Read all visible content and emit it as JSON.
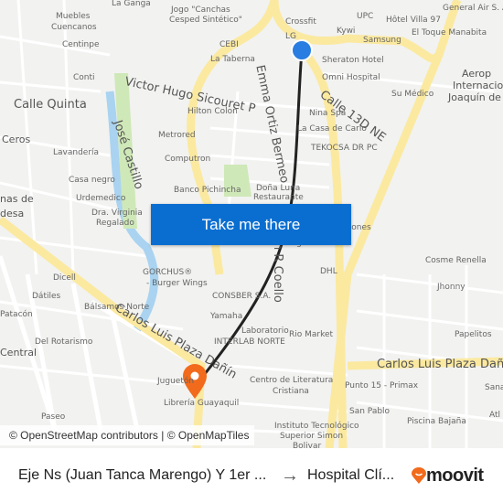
{
  "map": {
    "labels": [
      "La Ganga",
      "Jogo \"Canchas",
      "Cesped Sintético\"",
      "Crossfit",
      "UPC",
      "Hôtel Villa 97",
      "General Air S. A.",
      "Muebles",
      "Cuencanos",
      "Centinpe",
      "LG",
      "Kywi",
      "Samsung",
      "El Toque Manabita",
      "CEBI",
      "La Taberna",
      "Sheraton Hotel",
      "Conti",
      "Omni Hospital",
      "Su Médico",
      "Aerop",
      "Internacio",
      "Joaquín de",
      "Hilton Colon",
      "Nina Spa",
      "La Casa de Carlo",
      "Metrored",
      "TEKOCSA DR PC",
      "Lavandería",
      "Computron",
      "Casa negro",
      "Banco Pichincha",
      "Doña Luna",
      "Restaurante",
      "Urdemedico",
      "Dra. Virginia",
      "Regalado",
      "Samsung",
      "Colones",
      "DHL",
      "Cosme Renella",
      "Jhonny",
      "Dicell",
      "GORCHUS®",
      "- Burger Wings",
      "CONSBER S.A.",
      "Yamaha",
      "Laboratorio",
      "INTERLAB NORTE",
      "Rio Market",
      "Papelitos",
      "Juguetón",
      "Centro de Literatura",
      "Cristiana",
      "Librería Guayaquil",
      "Punto 15 - Primax",
      "San Pablo",
      "Piscina Bajaña",
      "Instituto Tecnológico",
      "Superior Simon",
      "Bolivar",
      "Paseo",
      "Dátiles",
      "Bálsamos Norte",
      "Del Rotarismo",
      "Central",
      "Patacón",
      "Ceros",
      "nas de",
      "desa",
      "Sana",
      "Atl"
    ],
    "streets": [
      "Victor Hugo Sicouret P",
      "Calle Quinta",
      "José Castillo",
      "Emma Ortiz Bermeo",
      "Calle 13D NE",
      "Juan R Coello",
      "Carlos Luis Plaza Dañín",
      "Carlos Luis Plaza Dañín",
      "Cosme Renella"
    ],
    "colors": {
      "background": "#f2f2f0",
      "major_road": "#fbe9a0",
      "park": "#cfe8b8",
      "water": "#a9d3f0",
      "route": "#222222",
      "origin": "#2a7de1",
      "destination": "#f26a1b"
    },
    "origin_icon": "origin-dot-icon",
    "destination_icon": "destination-pin-icon"
  },
  "cta": {
    "label": "Take me there"
  },
  "attribution": "© OpenStreetMap contributors | © OpenMapTiles",
  "footer": {
    "from": "Eje Ns (Juan Tanca Marengo) Y 1er ...",
    "arrow": "→",
    "to": "Hospital Clí...",
    "brand": "moovit"
  }
}
